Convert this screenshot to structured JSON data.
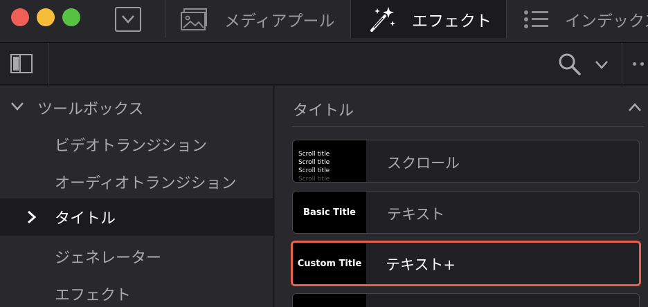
{
  "window": {
    "traffic_lights": {
      "close": "#ee5f57",
      "minimize": "#f6bd3a",
      "zoom": "#56c142"
    }
  },
  "tabs": [
    {
      "label": "メディアプール",
      "icon": "media-pool-icon",
      "active": false
    },
    {
      "label": "エフェクト",
      "icon": "magic-wand-icon",
      "active": true
    },
    {
      "label": "インデックス",
      "icon": "index-list-icon",
      "active": false
    }
  ],
  "sidebar": {
    "header": "ツールボックス",
    "items": [
      {
        "label": "ビデオトランジション",
        "selected": false
      },
      {
        "label": "オーディオトランジション",
        "selected": false
      },
      {
        "label": "タイトル",
        "selected": true
      },
      {
        "label": "ジェネレーター",
        "selected": false
      },
      {
        "label": "エフェクト",
        "selected": false
      }
    ]
  },
  "panel": {
    "section_title": "タイトル",
    "cards": [
      {
        "thumb_lines": [
          "Scroll title",
          "Scroll title",
          "Scroll title",
          "Scroll title"
        ],
        "name": "スクロール"
      },
      {
        "thumb": "Basic Title",
        "name": "テキスト"
      },
      {
        "thumb": "Custom Title",
        "name": "テキスト+",
        "highlighted": true
      }
    ]
  },
  "colors": {
    "highlight": "#e8604e",
    "active_tab_bg": "#1b1b1f"
  }
}
